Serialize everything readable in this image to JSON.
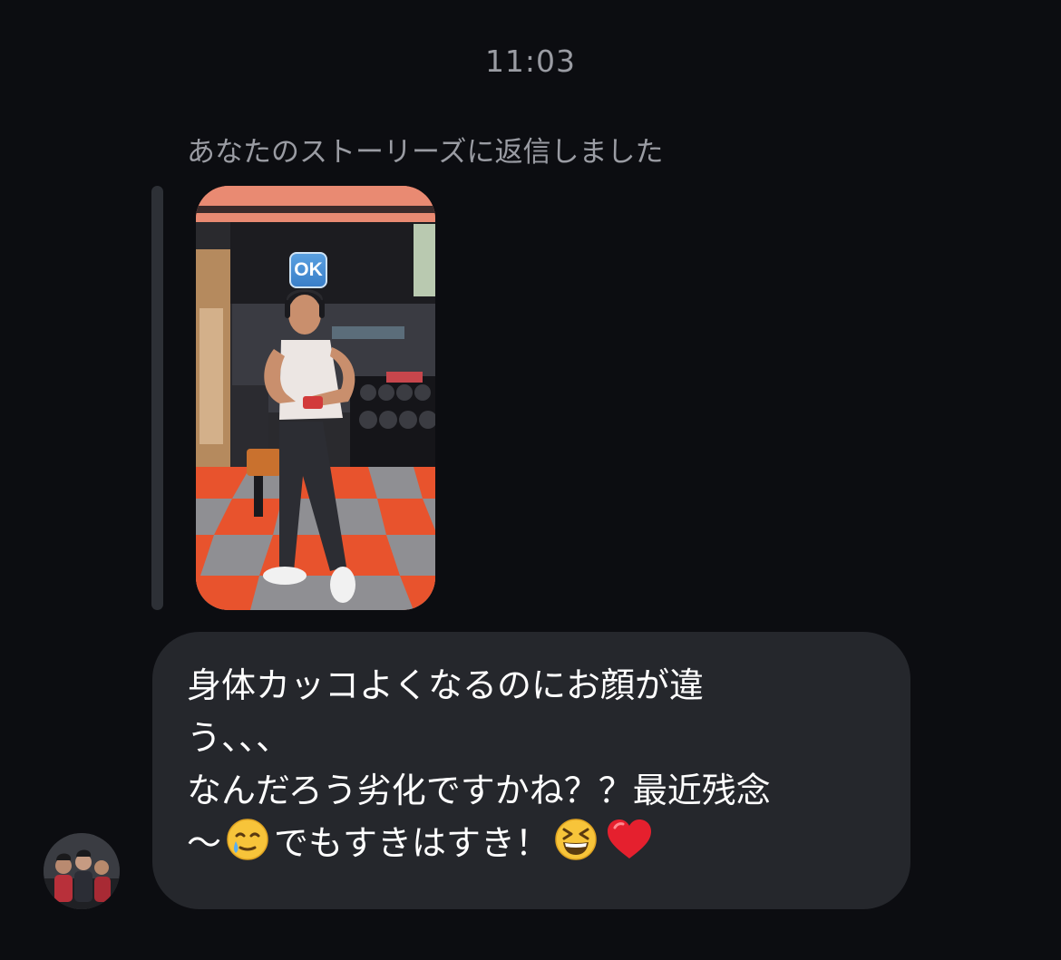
{
  "conversation": {
    "timestamp": "11:03",
    "reply_context": "あなたのストーリーズに返信しました",
    "story": {
      "sticker_text": "OK"
    },
    "message": {
      "line1": "身体カッコよくなるのにお顔が違",
      "line2": "う、、、",
      "line3": "なんだろう劣化ですかね？？最近残念",
      "line4a": "〜",
      "line4b": "でもすきはすき！",
      "emoji1": "smiling-face-with-tear-emoji",
      "emoji2": "grinning-squinting-face-emoji",
      "emoji3": "red-heart-emoji"
    },
    "colors": {
      "background": "#0c0d11",
      "bubble": "#25272c",
      "meta_text": "#9a9ca3"
    }
  }
}
